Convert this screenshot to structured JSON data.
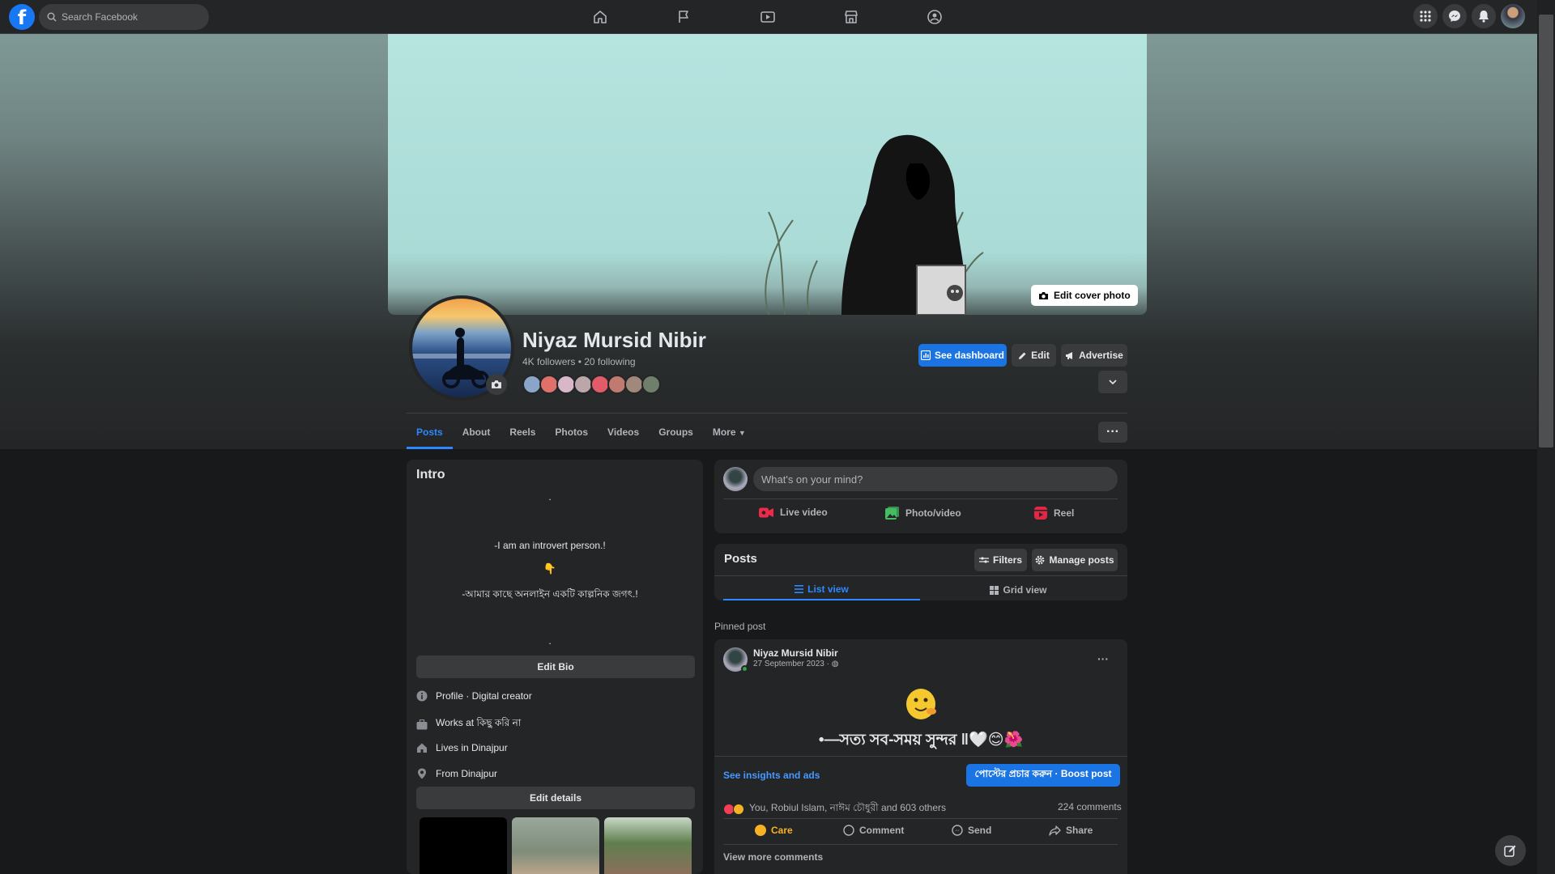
{
  "nav": {
    "search_placeholder": "Search Facebook",
    "center_icons": [
      "home-icon",
      "flag-icon",
      "video-icon",
      "marketplace-icon",
      "groups-icon"
    ],
    "right_icons": [
      "menu-grid-icon",
      "messenger-icon",
      "bell-icon"
    ]
  },
  "cover": {
    "edit_label": "Edit cover photo"
  },
  "profile": {
    "name": "Niyaz Mursid Nibir",
    "stats": "4K followers • 20 following",
    "friend_colors": [
      "#8aa5c7",
      "#e0706a",
      "#d8b7c8",
      "#bba6a9",
      "#e25b69",
      "#c07a70",
      "#a0887a",
      "#6f7f6a"
    ]
  },
  "actions": {
    "dashboard": "See dashboard",
    "edit": "Edit",
    "advertise": "Advertise"
  },
  "tabs": [
    "Posts",
    "About",
    "Reels",
    "Photos",
    "Videos",
    "Groups",
    "More"
  ],
  "intro": {
    "title": "Intro",
    "bio_lines": [
      ".",
      "-I am an introvert person.!",
      "👇",
      "-আমার কাছে অনলাইন একটি কাল্পনিক জগৎ.!",
      "."
    ],
    "edit_bio": "Edit Bio",
    "details": [
      {
        "icon": "info-icon",
        "text": "Profile · Digital creator"
      },
      {
        "icon": "briefcase-icon",
        "text": "Works at কিছু করি না"
      },
      {
        "icon": "home-icon",
        "text": "Lives in Dinajpur"
      },
      {
        "icon": "location-pin-icon",
        "text": "From Dinajpur"
      }
    ],
    "edit_details": "Edit details"
  },
  "composer": {
    "placeholder": "What's on your mind?",
    "actions": {
      "live": "Live video",
      "photo": "Photo/video",
      "reel": "Reel"
    }
  },
  "posts": {
    "title": "Posts",
    "filters": "Filters",
    "manage": "Manage posts",
    "list_view": "List view",
    "grid_view": "Grid view",
    "pinned_label": "Pinned post"
  },
  "post": {
    "author": "Niyaz Mursid Nibir",
    "date": "27 September 2023 ·",
    "text": "•—সত্য সব-সময় সুন্দর ‖🤍😊🌺",
    "insights": "See insights and ads",
    "boost": "পোস্টের প্রচার করুন · Boost post",
    "reactions_text": "You, Robiul Islam, নাঈম চৌধুরী and 603 others",
    "comments_count": "224 comments",
    "actions": {
      "care": "Care",
      "comment": "Comment",
      "send": "Send",
      "share": "Share"
    },
    "view_more": "View more comments"
  }
}
